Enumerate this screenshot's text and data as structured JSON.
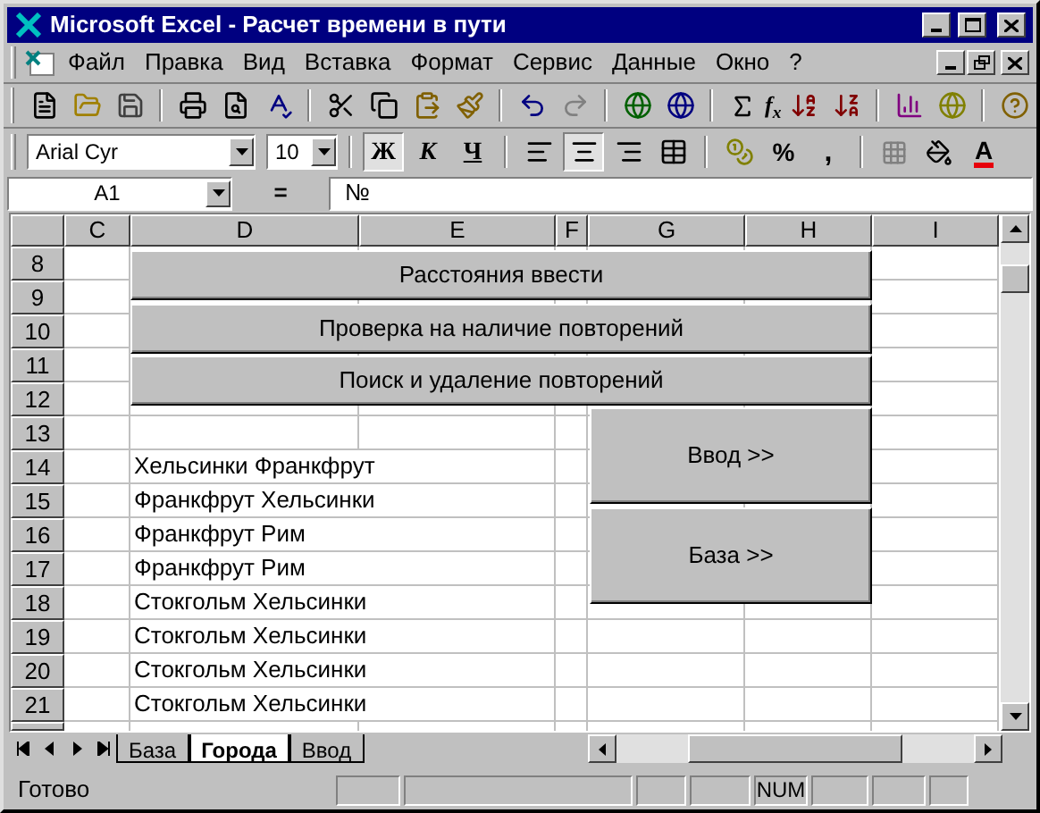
{
  "window": {
    "title": "Microsoft Excel - Расчет времени в пути"
  },
  "menu": [
    "Файл",
    "Правка",
    "Вид",
    "Вставка",
    "Формат",
    "Сервис",
    "Данные",
    "Окно",
    "?"
  ],
  "toolbar": {
    "function": "f$_{x}$"
  },
  "formatting": {
    "font": "Arial Cyr",
    "size": "10",
    "bold": "Ж",
    "italic": "К",
    "underline": "Ч",
    "percent": "%",
    "comma": ",",
    "font_color": "A",
    "align": [
      {
        "kind": "left",
        "selected": false
      },
      {
        "kind": "center",
        "selected": true
      },
      {
        "kind": "right",
        "selected": false
      }
    ]
  },
  "formula_bar": {
    "name_box": "A1",
    "equals": "=",
    "value": "№"
  },
  "columns": [
    "C",
    "D",
    "E",
    "F",
    "G",
    "H",
    "I"
  ],
  "rows": [
    {
      "number": "8"
    },
    {
      "number": "9"
    },
    {
      "number": "10"
    },
    {
      "number": "11"
    },
    {
      "number": "12"
    },
    {
      "number": "13"
    },
    {
      "number": "14",
      "d": "Хельсинки Франкфрут"
    },
    {
      "number": "15",
      "d": "Франкфрут Хельсинки"
    },
    {
      "number": "16",
      "d": "Франкфрут Рим"
    },
    {
      "number": "17",
      "d": "Франкфрут Рим"
    },
    {
      "number": "18",
      "d": "Стокгольм Хельсинки"
    },
    {
      "number": "19",
      "d": "Стокгольм Хельсинки"
    },
    {
      "number": "20",
      "d": "Стокгольм Хельсинки"
    },
    {
      "number": "21",
      "d": "Стокгольм Хельсинки"
    }
  ],
  "sheet_buttons": [
    {
      "kind": "wide",
      "label": "Расстояния ввести"
    },
    {
      "kind": "wide",
      "label": "Проверка на наличие повторений"
    },
    {
      "kind": "wide",
      "label": "Поиск и удаление повторений"
    },
    {
      "kind": "tall",
      "label": "Ввод >>"
    },
    {
      "kind": "tall",
      "label": "База >>"
    }
  ],
  "sheet_tabs": [
    {
      "label": "База",
      "selected": false
    },
    {
      "label": "Города",
      "selected": true
    },
    {
      "label": "Ввод",
      "selected": false
    }
  ],
  "status_bar": {
    "text": "Готово",
    "num_indicator": "NUM"
  }
}
